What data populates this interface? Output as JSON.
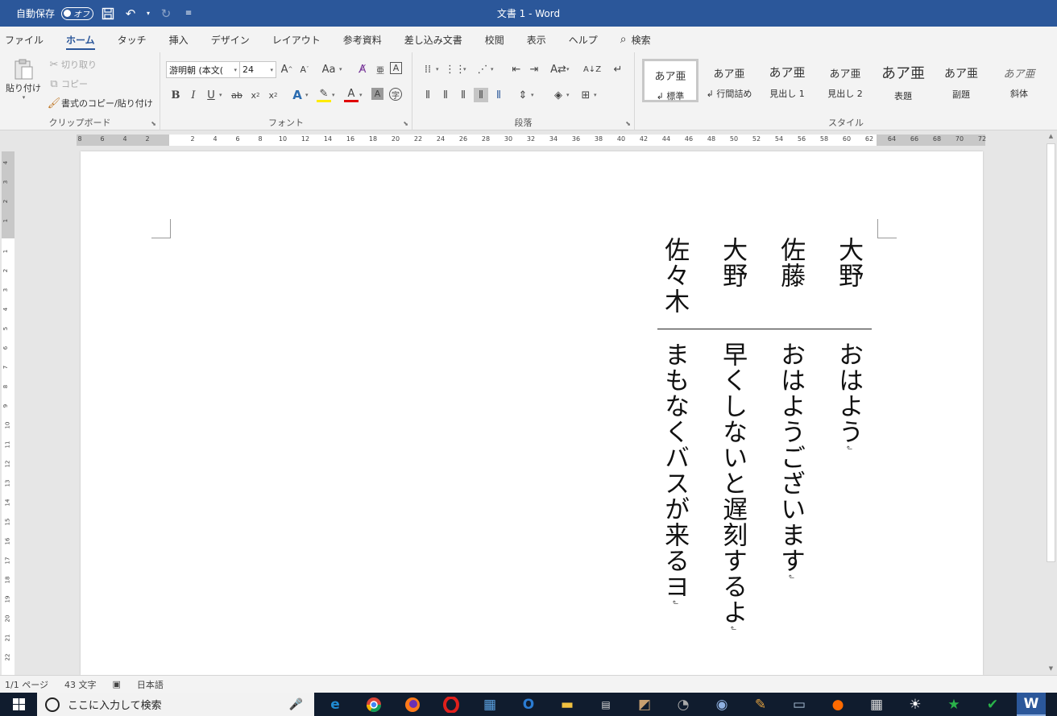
{
  "titlebar": {
    "autosave_label": "自動保存",
    "autosave_state": "オフ",
    "window_title": "文書 1  -  Word"
  },
  "tabs": [
    "ファイル",
    "ホーム",
    "タッチ",
    "挿入",
    "デザイン",
    "レイアウト",
    "参考資料",
    "差し込み文書",
    "校閲",
    "表示",
    "ヘルプ",
    "検索"
  ],
  "ribbon": {
    "clipboard": {
      "label": "クリップボード",
      "paste": "貼り付け",
      "cut": "切り取り",
      "copy": "コピー",
      "format_painter": "書式のコピー/貼り付け"
    },
    "font": {
      "label": "フォント",
      "font_name": "游明朝 (本文(",
      "font_size": "24"
    },
    "paragraph": {
      "label": "段落"
    },
    "styles": {
      "label": "スタイル",
      "sample": "あア亜",
      "items": [
        "↲ 標準",
        "↲ 行間詰め",
        "見出し 1",
        "見出し 2",
        "表題",
        "副題",
        "斜体"
      ]
    }
  },
  "ruler": {
    "h_ticks": [
      "8",
      "6",
      "4",
      "2",
      "2",
      "4",
      "6",
      "8",
      "10",
      "12",
      "14",
      "16",
      "18",
      "20",
      "22",
      "24",
      "26",
      "28",
      "30",
      "32",
      "34",
      "36",
      "38",
      "40",
      "42",
      "44",
      "46",
      "48",
      "50",
      "52",
      "54",
      "56",
      "58",
      "60",
      "62",
      "64",
      "66",
      "68",
      "70",
      "72"
    ],
    "v_ticks": [
      "4",
      "3",
      "2",
      "1",
      "1",
      "2",
      "3",
      "4",
      "5",
      "6",
      "7",
      "8",
      "9",
      "10",
      "11",
      "12",
      "13",
      "14",
      "15",
      "16",
      "17",
      "18",
      "19",
      "20",
      "21",
      "22"
    ]
  },
  "document": {
    "names": [
      "大野",
      "佐藤",
      "大野",
      "佐々木"
    ],
    "lines": [
      "おはよう",
      "おはようございます",
      "早くしないと遅刻するよ",
      "まもなくバスが来るヨ"
    ],
    "paragraph_mark": "↲"
  },
  "status": {
    "page": "1/1 ページ",
    "words": "43 文字",
    "language": "日本語"
  },
  "taskbar": {
    "search_placeholder": "ここに入力して検索"
  },
  "colors": {
    "word_blue": "#2b579a",
    "taskbar": "#101c2e"
  }
}
